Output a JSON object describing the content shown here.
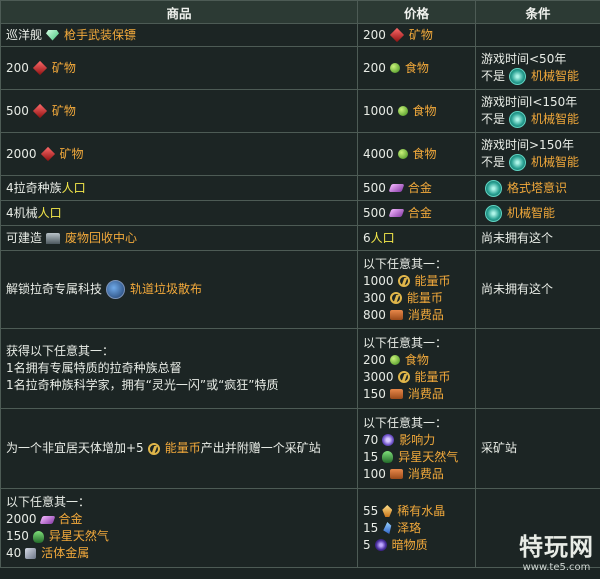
{
  "headers": {
    "goods": "商品",
    "price": "价格",
    "condition": "条件"
  },
  "rows": {
    "r1": {
      "goods_prefix": "巡洋舰",
      "goods_link": "枪手武装保镖",
      "price_amount": "200",
      "price_res": "矿物"
    },
    "r2": {
      "goods_amount": "200",
      "goods_res": "矿物",
      "price_amount": "200",
      "price_res": "食物",
      "cond_line1": "游戏时间<50年",
      "cond_not": "不是",
      "cond_trait": "机械智能"
    },
    "r3": {
      "goods_amount": "500",
      "goods_res": "矿物",
      "price_amount": "1000",
      "price_res": "食物",
      "cond_line1": "游戏时间l<150年",
      "cond_not": "不是",
      "cond_trait": "机械智能"
    },
    "r4": {
      "goods_amount": "2000",
      "goods_res": "矿物",
      "price_amount": "4000",
      "price_res": "食物",
      "cond_line1": "游戏时间>150年",
      "cond_not": "不是",
      "cond_trait": "机械智能"
    },
    "r5": {
      "goods_prefix": "4拉奇种族",
      "goods_pop": "人口",
      "price_amount": "500",
      "price_res": "合金",
      "cond_trait": "格式塔意识"
    },
    "r6": {
      "goods_prefix": "4机械",
      "goods_pop": "人口",
      "price_amount": "500",
      "price_res": "合金",
      "cond_trait": "机械智能"
    },
    "r7": {
      "goods_prefix": "可建造",
      "goods_link": "废物回收中心",
      "price_amount": "6",
      "price_pop": "人口",
      "cond": "尚未拥有这个"
    },
    "r8": {
      "goods_prefix": "解锁拉奇专属科技",
      "goods_link": "轨道垃圾散布",
      "price_head": "以下任意其一：",
      "price_lines": [
        {
          "amount": "1000",
          "res": "能量币"
        },
        {
          "amount": "300",
          "res": "能量币"
        },
        {
          "amount": "800",
          "res": "消费品"
        }
      ],
      "cond": "尚未拥有这个"
    },
    "r9": {
      "goods_lines": [
        "获得以下任意其一：",
        "1名拥有专属特质的拉奇种族总督",
        "1名拉奇种族科学家，拥有“灵光一闪”或“疯狂”特质"
      ],
      "price_head": "以下任意其一：",
      "price_lines": [
        {
          "amount": "200",
          "res": "食物"
        },
        {
          "amount": "3000",
          "res": "能量币"
        },
        {
          "amount": "150",
          "res": "消费品"
        }
      ]
    },
    "r10": {
      "goods_text1": "为一个非宜居天体增加+5",
      "goods_link": "能量币",
      "goods_text2": "产出并附赠一个采矿站",
      "price_head": "以下任意其一：",
      "price_lines": [
        {
          "amount": "70",
          "res": "影响力"
        },
        {
          "amount": "15",
          "res": "异星天然气"
        },
        {
          "amount": "100",
          "res": "消费品"
        }
      ],
      "cond": "采矿站"
    },
    "r11": {
      "goods_head": "以下任意其一：",
      "goods_lines": [
        {
          "amount": "2000",
          "res": "合金"
        },
        {
          "amount": "150",
          "res": "异星天然气"
        },
        {
          "amount": "40",
          "res": "活体金属"
        }
      ],
      "price_lines": [
        {
          "amount": "55",
          "res": "稀有水晶"
        },
        {
          "amount": "15",
          "res": "泽珞"
        },
        {
          "amount": "5",
          "res": "暗物质"
        }
      ]
    }
  },
  "watermark": {
    "brand": "特玩网",
    "url": "www.te5.com"
  }
}
